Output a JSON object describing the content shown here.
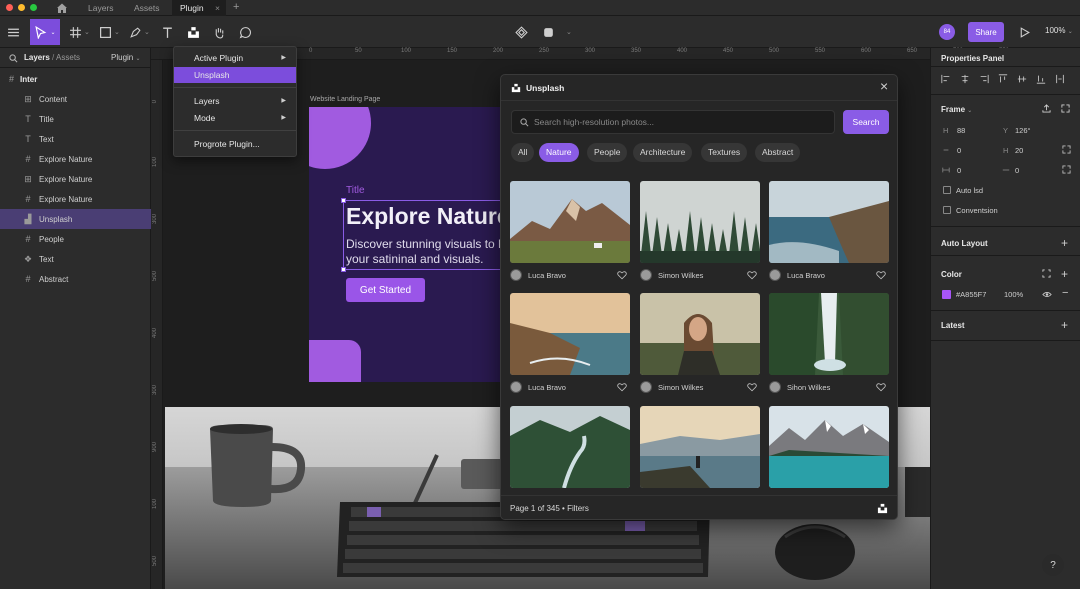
{
  "titlebar": {
    "tabs": [
      "Layers",
      "Assets",
      "Plugin"
    ],
    "active_tab_close": "×",
    "new_tab": "+"
  },
  "toolbar": {
    "share_label": "Share",
    "zoom_label": "100%",
    "avatar_initials": "84"
  },
  "left_panel": {
    "breadcrumb_layers": "Layers",
    "breadcrumb_sep": "/",
    "breadcrumb_assets": "Assets",
    "plugin_dropdown": "Plugin",
    "root_label": "Inter",
    "layers": [
      {
        "label": "Content",
        "icon": "grid-icon"
      },
      {
        "label": "Title",
        "icon": "text-icon"
      },
      {
        "label": "Text",
        "icon": "text-icon"
      },
      {
        "label": "Explore Nature",
        "icon": "frame-icon"
      },
      {
        "label": "Explore Nature",
        "icon": "grid-icon"
      },
      {
        "label": "Explore Nature",
        "icon": "frame-icon"
      },
      {
        "label": "Unsplash",
        "icon": "unsplash-icon"
      },
      {
        "label": "People",
        "icon": "frame-icon"
      },
      {
        "label": "Text",
        "icon": "component-icon"
      },
      {
        "label": "Abstract",
        "icon": "frame-icon"
      }
    ]
  },
  "ruler": {
    "top": [
      "0",
      "50",
      "100",
      "150",
      "200",
      "250",
      "300",
      "350",
      "400",
      "450",
      "500",
      "550",
      "600",
      "650",
      "700",
      "750"
    ],
    "left": [
      "0",
      "100",
      "300",
      "500",
      "400",
      "300",
      "900",
      "100",
      "500"
    ]
  },
  "menu": {
    "items": [
      "Active Plugin",
      "Unsplash",
      "Layers",
      "Mode",
      "Progrote Plugin..."
    ]
  },
  "canvas": {
    "frame_label": "Website Landing Page",
    "title_small": "Title",
    "headline": "Explore Nature",
    "body_line1": "Discover stunning visuals to h",
    "body_line2": "your satininal and visuals.",
    "cta_label": "Get Started"
  },
  "plugin": {
    "title": "Unsplash",
    "close": "×",
    "search_placeholder": "Search high-resolution photos...",
    "search_button": "Search",
    "chips": [
      "All",
      "Nature",
      "People",
      "Architecture",
      "Textures",
      "Abstract"
    ],
    "active_chip": "Nature",
    "photos": [
      {
        "author": "Luca Bravo",
        "scene": "mountain-valley"
      },
      {
        "author": "Simon Wilkes",
        "scene": "misty-forest"
      },
      {
        "author": "Luca Bravo",
        "scene": "coastal-cliffs"
      },
      {
        "author": "Luca Bravo",
        "scene": "sunset-coast"
      },
      {
        "author": "Simon Wilkes",
        "scene": "woman-portrait"
      },
      {
        "author": "Sihon Wilkes",
        "scene": "waterfall"
      },
      {
        "author": "",
        "scene": "river-forest"
      },
      {
        "author": "",
        "scene": "lake-hiker"
      },
      {
        "author": "",
        "scene": "turquoise-lake"
      }
    ],
    "footer": "Page 1 of 345 • Filters"
  },
  "right_panel": {
    "title": "Properties Panel",
    "frame_label": "Frame",
    "w_label": "H",
    "w_value": "88",
    "y_label": "Y",
    "y_value": "126°",
    "r1_value": "0",
    "r2_label": "H",
    "r2_value": "20",
    "r3_value": "0",
    "r4_value": "0",
    "check1": "Auto lsd",
    "check2": "Conventsion",
    "auto_layout": "Auto Layout",
    "color_label": "Color",
    "color_hex": "#A855F7",
    "color_swatch": "#a855f7",
    "color_opacity": "100%",
    "latest_label": "Latest"
  },
  "help": "?"
}
